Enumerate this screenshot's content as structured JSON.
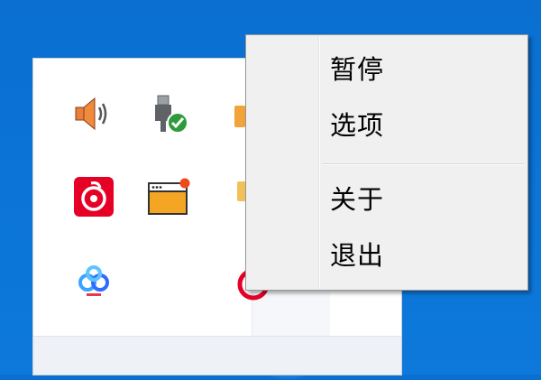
{
  "tray": {
    "icons": [
      {
        "name": "speaker-icon"
      },
      {
        "name": "usb-safe-remove-icon"
      },
      {
        "name": "netease-music-icon"
      },
      {
        "name": "window-notification-icon"
      },
      {
        "name": "baidu-netdisk-icon"
      },
      {
        "name": "red-circle-app-icon"
      }
    ]
  },
  "context_menu": {
    "items": [
      "暂停",
      "选项",
      "关于",
      "退出"
    ]
  },
  "colors": {
    "desktop": "#0b73d6",
    "menu_bg": "#f0f0f0",
    "menu_border": "#979797",
    "netease_red": "#e60026",
    "notify_orange": "#f5a524"
  }
}
